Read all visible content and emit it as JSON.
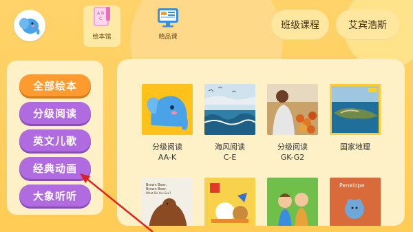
{
  "header": {
    "tabs": [
      {
        "label": "绘本馆",
        "icon": "picture-book-icon",
        "active": true
      },
      {
        "label": "精品课",
        "icon": "monitor-icon",
        "active": false
      }
    ],
    "buttons": [
      {
        "label": "班级课程"
      },
      {
        "label": "艾宾浩斯"
      }
    ]
  },
  "sidebar": {
    "items": [
      {
        "label": "全部绘本",
        "active": true
      },
      {
        "label": "分级阅读",
        "active": false
      },
      {
        "label": "英文儿歌",
        "active": false
      },
      {
        "label": "经典动画",
        "active": false
      },
      {
        "label": "大象听听",
        "active": false
      }
    ]
  },
  "books": [
    {
      "line1": "分级阅读",
      "line2": "AA-K",
      "cover": "elephant-cover"
    },
    {
      "line1": "海风阅读",
      "line2": "C-E",
      "cover": "seascape-cover"
    },
    {
      "line1": "分级阅读",
      "line2": "GK-G2",
      "cover": "market-photo-cover"
    },
    {
      "line1": "国家地理",
      "line2": "",
      "cover": "island-photo-cover"
    },
    {
      "line1": "",
      "line2": "",
      "cover": "brown-bear-book-cover",
      "cover_text": "Brown Bear, Brown Bear, What Do You See?"
    },
    {
      "line1": "",
      "line2": "",
      "cover": "cartoon-animals-cover"
    },
    {
      "line1": "",
      "line2": "",
      "cover": "children-cover"
    },
    {
      "line1": "",
      "line2": "",
      "cover": "penelope-book-cover",
      "cover_text": "Penelope"
    }
  ],
  "colors": {
    "background": "#ffcc55",
    "panel": "#fff1c7",
    "active_item": "#ff9a2e",
    "item": "#b06be0",
    "arrow": "#e0201b"
  }
}
